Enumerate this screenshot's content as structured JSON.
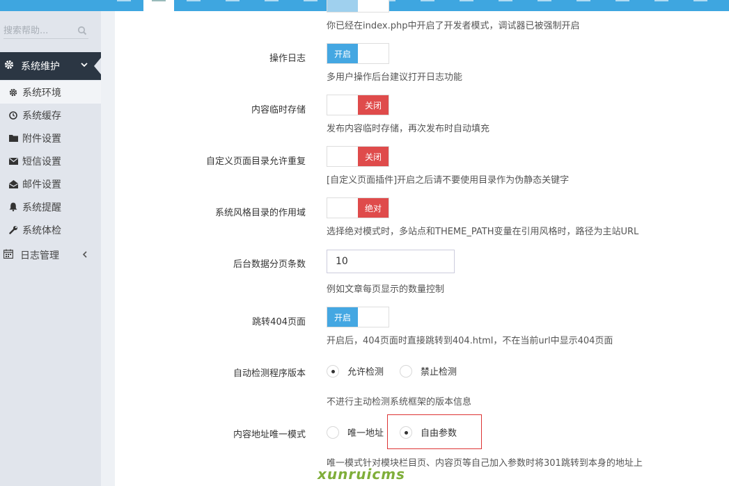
{
  "sidebar": {
    "search_placeholder": "搜索帮助...",
    "group": {
      "label": "系统维护"
    },
    "items": [
      {
        "label": "系统环境",
        "icon": "gear-icon"
      },
      {
        "label": "系统缓存",
        "icon": "clock-icon"
      },
      {
        "label": "附件设置",
        "icon": "folder-icon"
      },
      {
        "label": "短信设置",
        "icon": "envelope-icon"
      },
      {
        "label": "邮件设置",
        "icon": "envelope-open-icon"
      },
      {
        "label": "系统提醒",
        "icon": "bell-icon"
      },
      {
        "label": "系统体检",
        "icon": "wrench-icon"
      }
    ],
    "group2": {
      "label": "日志管理"
    }
  },
  "settings": {
    "developer_help": "你已经在index.php中开启了开发者模式，调试器已被强制开启",
    "oplog": {
      "label": "操作日志",
      "state": "开启",
      "help": "多用户操作后台建议打开日志功能"
    },
    "tempstore": {
      "label": "内容临时存储",
      "state": "关闭",
      "help": "发布内容临时存储，再次发布时自动填充"
    },
    "pagedir": {
      "label": "自定义页面目录允许重复",
      "state": "关闭",
      "help": "[自定义页面插件]开启之后请不要使用目录作为伪静态关键字"
    },
    "themescope": {
      "label": "系统风格目录的作用域",
      "state": "绝对",
      "help": "选择绝对模式时，多站点和THEME_PATH变量在引用风格时，路径为主站URL"
    },
    "pagesize": {
      "label": "后台数据分页条数",
      "value": "10",
      "help": "例如文章每页显示的数量控制"
    },
    "jump404": {
      "label": "跳转404页面",
      "state": "开启",
      "help": "开启后，404页面时直接跳转到404.html，不在当前url中显示404页面"
    },
    "version_check": {
      "label": "自动检测程序版本",
      "opt1": "允许检测",
      "opt2": "禁止检测",
      "help": "不进行主动检测系统框架的版本信息"
    },
    "url_mode": {
      "label": "内容地址唯一模式",
      "opt1": "唯一地址",
      "opt2": "自由参数",
      "help": "唯一模式针对模块栏目页、内容页等自己加入参数时将301跳转到本身的地址上"
    }
  },
  "colors": {
    "topbar": "#3ea6e0",
    "switch_on": "#44a7e2",
    "switch_off": "#df4b4b",
    "sidebar_dark": "#2b3643"
  },
  "watermark": "xunruicms"
}
